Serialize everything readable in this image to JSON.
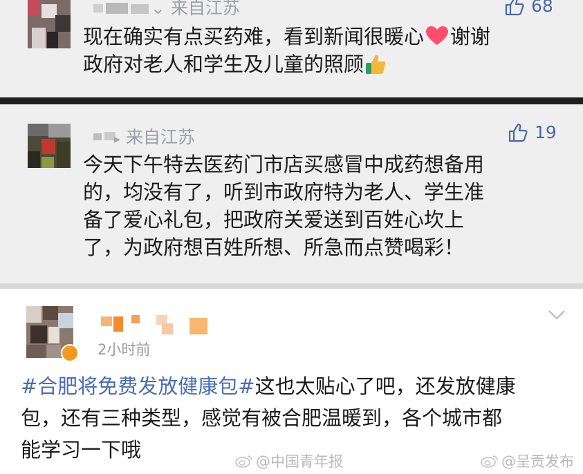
{
  "comments": [
    {
      "location": "来自江苏",
      "likes": "68",
      "lines": [
        "现在确实有点买药难，看到新闻很暖心",
        "谢谢",
        "政府对老人和学生及儿童的照顾"
      ]
    },
    {
      "location": "来自江苏",
      "likes": "19",
      "lines": [
        "今天下午特去医药门市店买感冒中成药想备用",
        "的，均没有了，听到市政府特为老人、学生准",
        "备了爱心礼包，把政府关爱送到百姓心坎上",
        "了，为政府想百姓所想、所急而点赞喝彩！"
      ]
    },
    {
      "time": "2小时前",
      "hashtag": "#合肥将免费发放健康包#",
      "lines": [
        "这也太贴心了吧，还发放健康",
        "包，还有三种类型，感觉有被合肥温暖到，各个城市都",
        "能学习一下哦"
      ]
    }
  ],
  "watermarks": [
    "@中国青年报",
    "@呈贡发布"
  ],
  "colors": {
    "hashtag": "#4a6db5",
    "like": "#4a67a8",
    "meta": "#9aa0a6",
    "heart": "#ff4d6d"
  }
}
